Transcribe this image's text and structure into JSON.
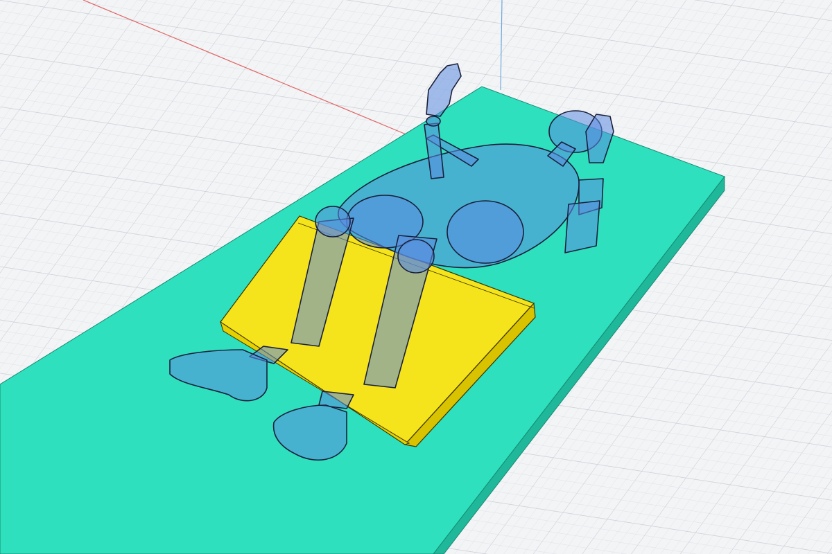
{
  "viewport": {
    "background": "#f3f4f6",
    "grid_minor_color": "#dfe2e7",
    "grid_major_color": "#c9cdd4",
    "axis_x_color": "#e06666",
    "axis_y_color": "#6fa8dc"
  },
  "scene": {
    "objects": [
      {
        "name": "mat",
        "color": "#2ee0bd",
        "side_color": "#1fb89a"
      },
      {
        "name": "wedge-cushion",
        "color": "#f5e31c",
        "side_color": "#d9c200"
      },
      {
        "name": "mannequin",
        "color": "#5b8de0",
        "outline_color": "#1a1f3a",
        "opacity": 0.55
      }
    ]
  }
}
